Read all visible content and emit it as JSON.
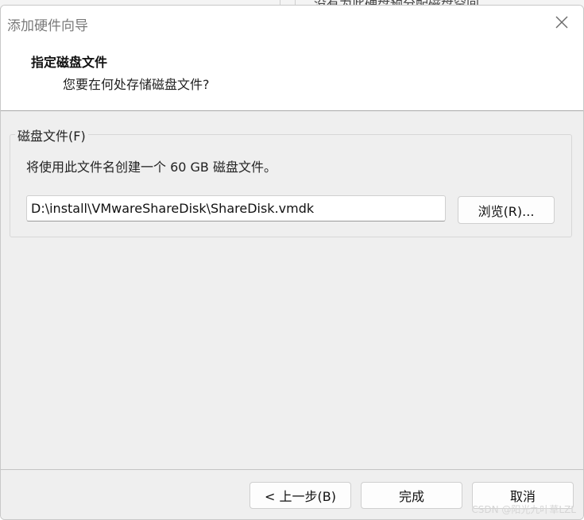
{
  "background_window": {
    "text": "没有为此硬盘预分配磁盘空间"
  },
  "dialog": {
    "title": "添加硬件向导",
    "close_icon": "close-icon",
    "header": {
      "step_title": "指定磁盘文件",
      "step_subtitle": "您要在何处存储磁盘文件?"
    },
    "disk_file_group": {
      "label": "磁盘文件(F)",
      "info": "将使用此文件名创建一个 60 GB 磁盘文件。",
      "path_value": "D:\\install\\VMwareShareDisk\\ShareDisk.vmdk",
      "browse_label": "浏览(R)..."
    },
    "footer": {
      "back_label": "< 上一步(B)",
      "finish_label": "完成",
      "cancel_label": "取消"
    }
  },
  "watermark": "CSDN @阳光九叶草LZL"
}
